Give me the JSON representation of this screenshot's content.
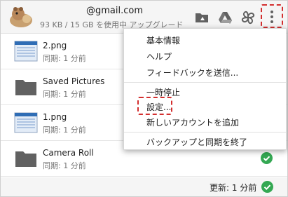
{
  "header": {
    "email": "@gmail.com",
    "quota": "93 KB / 15 GB を使用中",
    "upgrade": "アップグレード",
    "icons": [
      "drive-folder-icon",
      "google-drive-icon",
      "pinwheel-icon",
      "more-vert-icon"
    ]
  },
  "files": [
    {
      "name": "2.png",
      "status": "同期: 1 分前",
      "icon": "image-file-icon",
      "synced": false
    },
    {
      "name": "Saved Pictures",
      "status": "同期: 1 分前",
      "icon": "folder-icon",
      "synced": false
    },
    {
      "name": "1.png",
      "status": "同期: 1 分前",
      "icon": "image-file-icon",
      "synced": false
    },
    {
      "name": "Camera Roll",
      "status": "同期: 1 分前",
      "icon": "folder-icon",
      "synced": true
    }
  ],
  "footer": {
    "status": "更新: 1 分前"
  },
  "menu": {
    "items": [
      "基本情報",
      "ヘルプ",
      "フィードバックを送信...",
      "一時停止",
      "設定...",
      "新しいアカウントを追加",
      "バックアップと同期を終了"
    ]
  },
  "colors": {
    "accent_red": "#d32f2f",
    "check_green": "#34a853"
  }
}
